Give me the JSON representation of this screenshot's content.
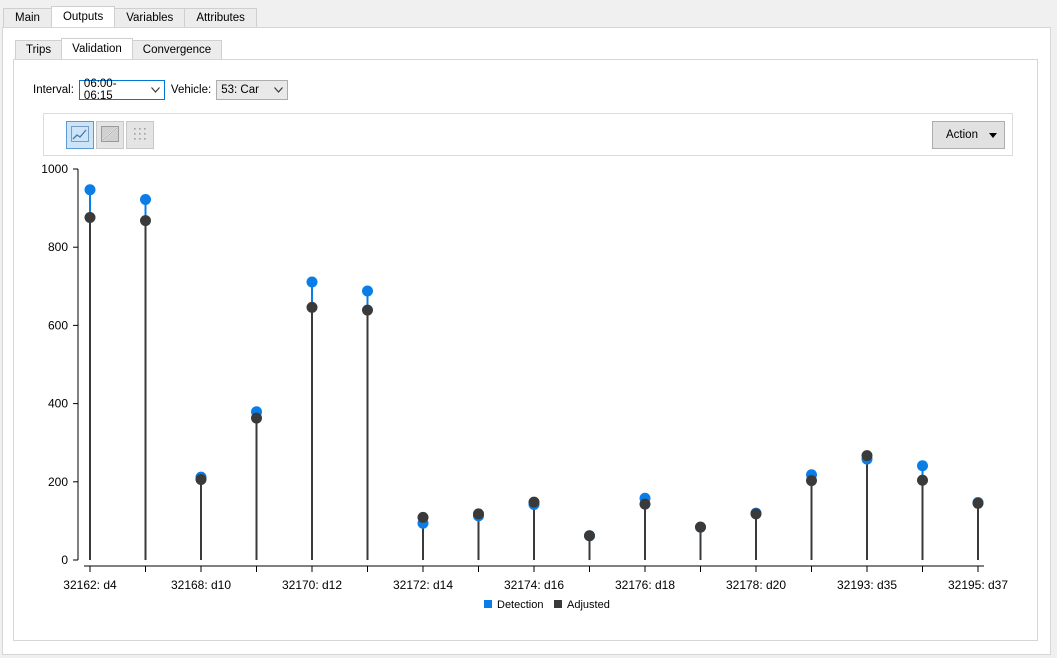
{
  "tabs": [
    "Main",
    "Outputs",
    "Variables",
    "Attributes"
  ],
  "active_tab": 1,
  "subtabs": [
    "Trips",
    "Validation",
    "Convergence"
  ],
  "active_subtab": 1,
  "filters": {
    "interval_label": "Interval:",
    "interval_value": "06:00-06:15",
    "vehicle_label": "Vehicle:",
    "vehicle_value": "53: Car"
  },
  "toolbar": {
    "icons": [
      "line-chart-icon",
      "scatter-diagonal-icon",
      "grid-dots-icon"
    ],
    "action_label": "Action"
  },
  "colors": {
    "detection": "#0a7ee6",
    "adjusted": "#3a3a3a"
  },
  "chart_data": {
    "type": "scatter",
    "subtype": "lollipop",
    "ylim": [
      0,
      1000
    ],
    "yticks": [
      0,
      200,
      400,
      600,
      800,
      1000
    ],
    "categories": [
      "32162: d4",
      "",
      "32168: d10",
      "",
      "32170: d12",
      "",
      "32172: d14",
      "",
      "32174: d16",
      "",
      "32176: d18",
      "",
      "32178: d20",
      "",
      "32193: d35",
      "",
      "32195: d37"
    ],
    "series": [
      {
        "name": "Detection",
        "values": [
          947,
          922,
          212,
          379,
          711,
          688,
          94,
          113,
          142,
          62,
          158,
          84,
          120,
          218,
          258,
          241,
          147
        ]
      },
      {
        "name": "Adjusted",
        "values": [
          876,
          868,
          206,
          363,
          646,
          639,
          109,
          118,
          148,
          62,
          143,
          84,
          118,
          203,
          267,
          204,
          145
        ]
      }
    ],
    "legend_position": "bottom-center",
    "grid": false
  }
}
